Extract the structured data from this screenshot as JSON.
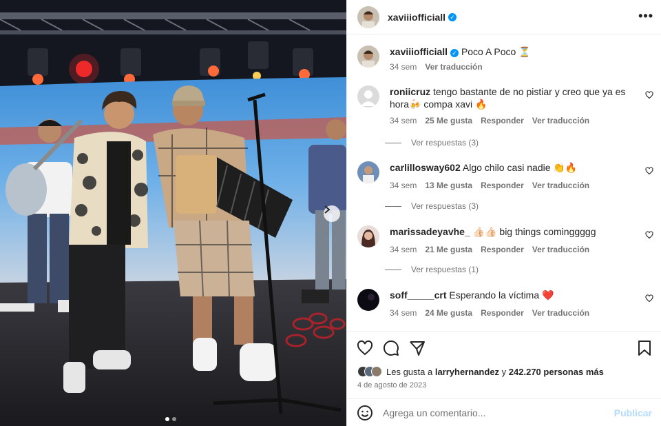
{
  "post": {
    "username": "xaviiiofficiall",
    "caption": "Poco A Poco ⏳",
    "caption_age": "34 sem",
    "see_translation": "Ver traducción"
  },
  "comments": [
    {
      "username": "roniicruz",
      "text": "tengo bastante de no pistiar y creo que ya es hora🍻 compa xavi 🔥",
      "age": "34 sem",
      "likes": "25 Me gusta",
      "reply": "Responder",
      "translate": "Ver traducción",
      "view_replies": "Ver respuestas (3)"
    },
    {
      "username": "carlillosway602",
      "text": "Algo chilo casi nadie 👏🔥",
      "age": "34 sem",
      "likes": "13 Me gusta",
      "reply": "Responder",
      "translate": "Ver traducción",
      "view_replies": "Ver respuestas (3)"
    },
    {
      "username": "marissadeyavhe_",
      "text": "👍🏻👍🏻 big things cominggggg",
      "age": "34 sem",
      "likes": "21 Me gusta",
      "reply": "Responder",
      "translate": "Ver traducción",
      "view_replies": "Ver respuestas (1)"
    },
    {
      "username": "soff_____crt",
      "text": "Esperando la víctima ❤️",
      "age": "34 sem",
      "likes": "24 Me gusta",
      "reply": "Responder",
      "translate": "Ver traducción"
    }
  ],
  "likes_summary": {
    "prefix": "Les gusta a",
    "user": "larryhernandez",
    "joiner": "y",
    "others": "242.270 personas más"
  },
  "date": "4 de agosto de 2023",
  "add_comment": {
    "placeholder": "Agrega un comentario...",
    "post_label": "Publicar"
  },
  "colors": {
    "verified": "#0095f6",
    "post_disabled": "#b3dbff",
    "muted": "#737373"
  }
}
